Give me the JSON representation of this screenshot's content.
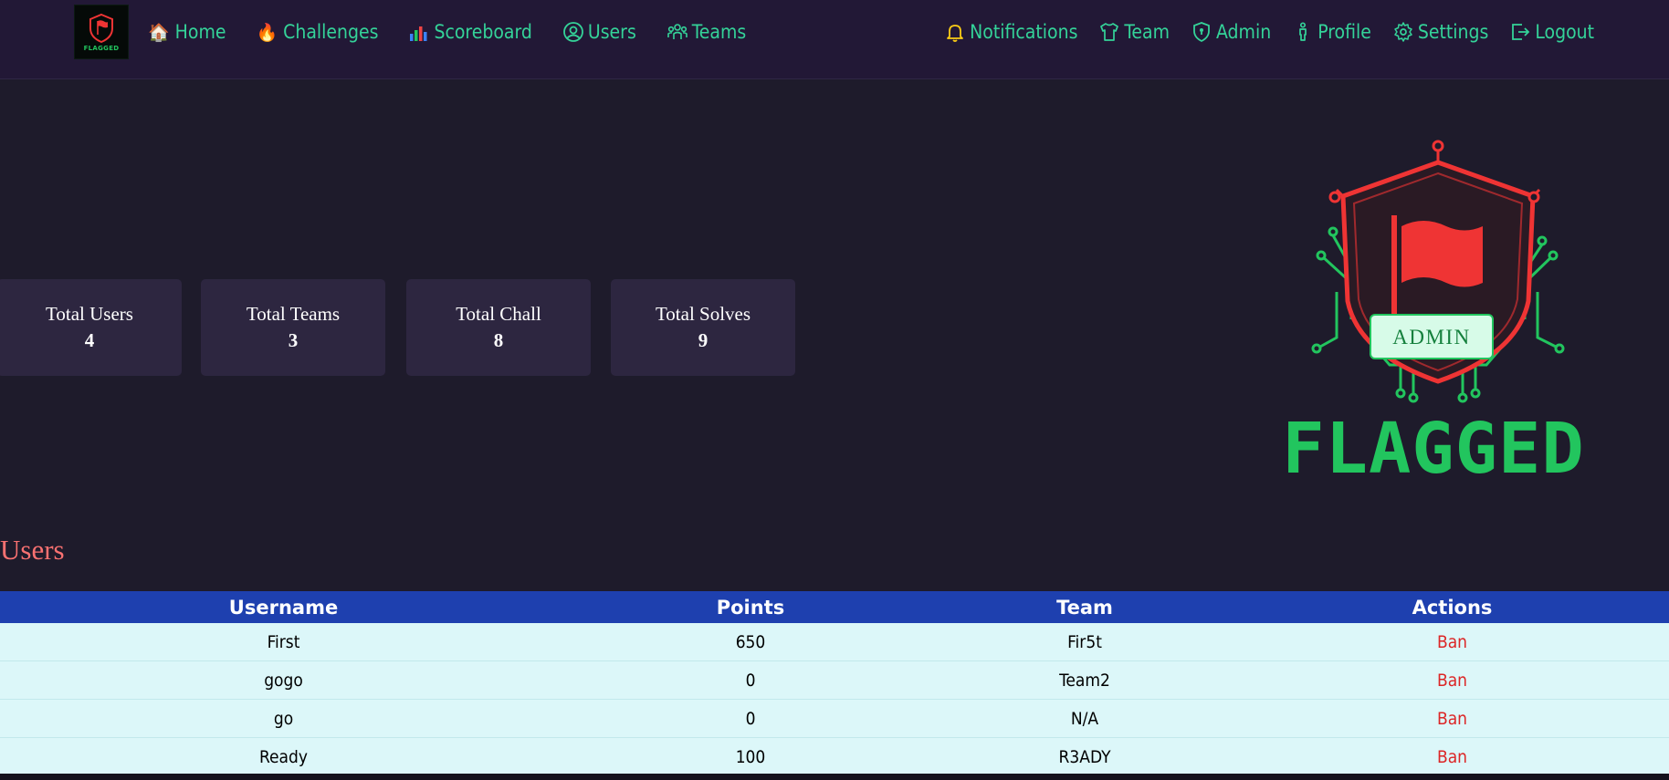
{
  "brand": {
    "logo_text": "FLAGGED"
  },
  "nav": {
    "left": [
      {
        "label": "Home",
        "icon": "home-icon"
      },
      {
        "label": "Challenges",
        "icon": "fire-icon"
      },
      {
        "label": "Scoreboard",
        "icon": "bar-chart-icon"
      },
      {
        "label": "Users",
        "icon": "user-circle-icon"
      },
      {
        "label": "Teams",
        "icon": "people-icon"
      }
    ],
    "right": [
      {
        "label": "Notifications",
        "icon": "bell-icon"
      },
      {
        "label": "Team",
        "icon": "shirt-icon"
      },
      {
        "label": "Admin",
        "icon": "shield-icon"
      },
      {
        "label": "Profile",
        "icon": "person-icon"
      },
      {
        "label": "Settings",
        "icon": "gear-icon"
      },
      {
        "label": "Logout",
        "icon": "logout-icon"
      }
    ]
  },
  "stats": [
    {
      "label": "Total Users",
      "value": "4"
    },
    {
      "label": "Total Teams",
      "value": "3"
    },
    {
      "label": "Total Chall",
      "value": "8"
    },
    {
      "label": "Total Solves",
      "value": "9"
    }
  ],
  "emblem": {
    "badge": "ADMIN",
    "wordmark": "FLAGGED"
  },
  "users_section": {
    "title": "Users",
    "columns": [
      "Username",
      "Points",
      "Team",
      "Actions"
    ],
    "rows": [
      {
        "username": "First",
        "points": "650",
        "team": "Fir5t",
        "action": "Ban"
      },
      {
        "username": "gogo",
        "points": "0",
        "team": "Team2",
        "action": "Ban"
      },
      {
        "username": "go",
        "points": "0",
        "team": "N/A",
        "action": "Ban"
      },
      {
        "username": "Ready",
        "points": "100",
        "team": "R3ADY",
        "action": "Ban"
      }
    ]
  },
  "colors": {
    "background": "#1e1b2b",
    "navbar": "#221836",
    "nav_text": "#34d399",
    "card": "#2d2640",
    "section_title": "#f87171",
    "table_header": "#1e40af",
    "table_row": "#dcf7f9",
    "ban": "#dc2626",
    "emblem_red": "#ef3434",
    "emblem_green": "#22c55e"
  }
}
